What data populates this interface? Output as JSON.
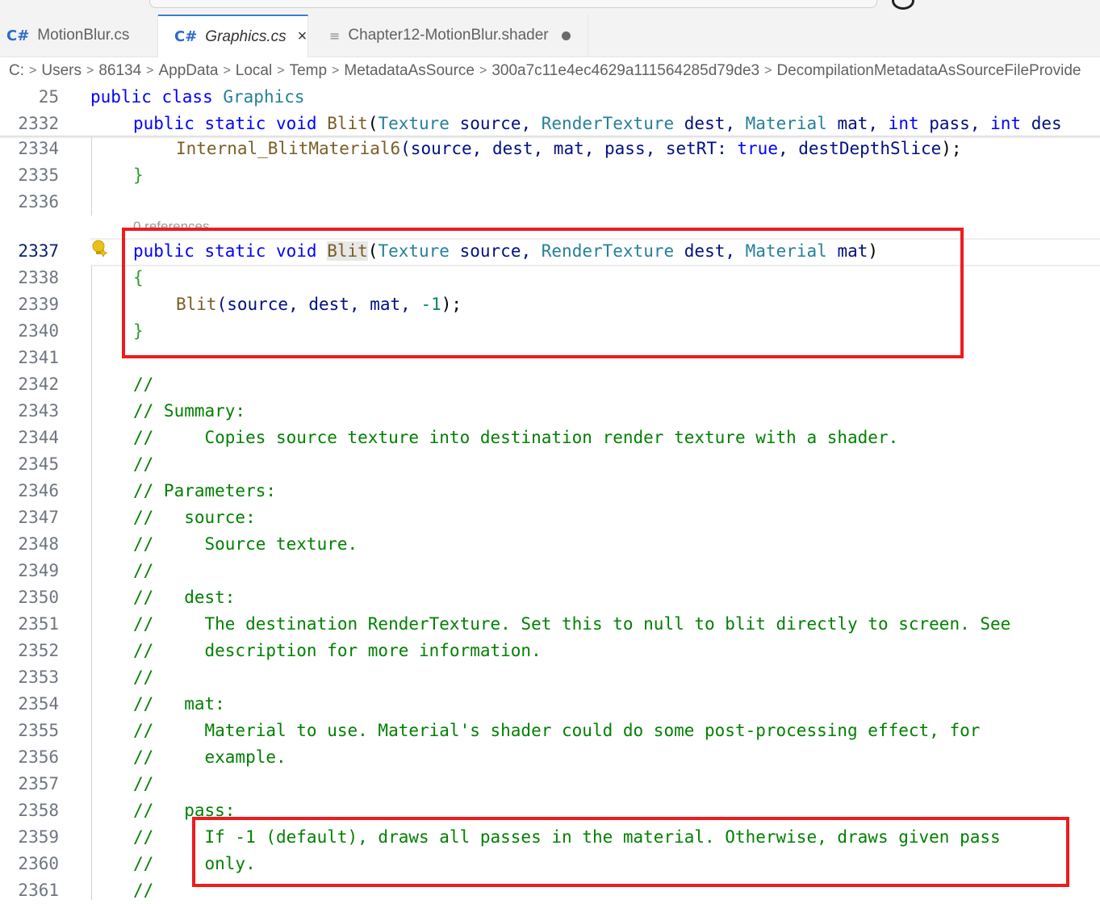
{
  "tabs": [
    {
      "label": "MotionBlur.cs",
      "icon": "C#",
      "state": "inactive"
    },
    {
      "label": "Graphics.cs",
      "icon": "C#",
      "state": "active",
      "close": "×"
    },
    {
      "label": "Chapter12-MotionBlur.shader",
      "icon": "≡",
      "state": "modified"
    }
  ],
  "breadcrumb": [
    "C:",
    "Users",
    "86134",
    "AppData",
    "Local",
    "Temp",
    "MetadataAsSource",
    "300a7c11e4ec4629a111564285d79de3",
    "DecompilationMetadataAsSourceFileProvide"
  ],
  "breadcrumb_separator": ">",
  "codelens": "0 references",
  "colors": {
    "keyword": "#0000ff",
    "type": "#267f99",
    "method": "#795e26",
    "parameter": "#001080",
    "comment": "#008000",
    "number": "#098658",
    "highlight_box": "#ee1c1c"
  },
  "lines": {
    "l25": {
      "num": "25",
      "t1": "public class ",
      "t2": "Graphics"
    },
    "l2332": {
      "num": "2332",
      "a": "public static void ",
      "b": "Blit",
      "c": "(",
      "d": "Texture",
      "e": " source, ",
      "f": "RenderTexture",
      "g": " dest, ",
      "h": "Material",
      "i": " mat, ",
      "j": "int",
      "k": " pass, ",
      "l": "int",
      "m": " des"
    },
    "l2334": {
      "num": "2334",
      "a": "Internal_BlitMaterial6",
      "b": "(source, dest, mat, pass, setRT: ",
      "c": "true",
      "d": ", destDepthSlice",
      "e": ");"
    },
    "l2335": {
      "num": "2335",
      "text": "}"
    },
    "l2336": {
      "num": "2336"
    },
    "l2337": {
      "num": "2337",
      "a": "public static void ",
      "b": "Blit",
      "c": "(",
      "d": "Texture",
      "e": " source, ",
      "f": "RenderTexture",
      "g": " dest, ",
      "h": "Material",
      "i": " mat",
      "j": ")"
    },
    "l2338": {
      "num": "2338",
      "text": "{"
    },
    "l2339": {
      "num": "2339",
      "a": "Blit",
      "b": "(source, dest, mat, ",
      "c": "-1",
      "d": ");"
    },
    "l2340": {
      "num": "2340",
      "text": "}"
    },
    "l2341": {
      "num": "2341"
    },
    "l2342": {
      "num": "2342",
      "text": "//"
    },
    "l2343": {
      "num": "2343",
      "text": "// Summary:"
    },
    "l2344": {
      "num": "2344",
      "text": "//     Copies source texture into destination render texture with a shader."
    },
    "l2345": {
      "num": "2345",
      "text": "//"
    },
    "l2346": {
      "num": "2346",
      "text": "// Parameters:"
    },
    "l2347": {
      "num": "2347",
      "text": "//   source:"
    },
    "l2348": {
      "num": "2348",
      "text": "//     Source texture."
    },
    "l2349": {
      "num": "2349",
      "text": "//"
    },
    "l2350": {
      "num": "2350",
      "text": "//   dest:"
    },
    "l2351": {
      "num": "2351",
      "text": "//     The destination RenderTexture. Set this to null to blit directly to screen. See"
    },
    "l2352": {
      "num": "2352",
      "text": "//     description for more information."
    },
    "l2353": {
      "num": "2353",
      "text": "//"
    },
    "l2354": {
      "num": "2354",
      "text": "//   mat:"
    },
    "l2355": {
      "num": "2355",
      "text": "//     Material to use. Material's shader could do some post-processing effect, for"
    },
    "l2356": {
      "num": "2356",
      "text": "//     example."
    },
    "l2357": {
      "num": "2357",
      "text": "//"
    },
    "l2358": {
      "num": "2358",
      "text": "//   pass:"
    },
    "l2359": {
      "num": "2359",
      "text": "//     If -1 (default), draws all passes in the material. Otherwise, draws given pass"
    },
    "l2360": {
      "num": "2360",
      "text": "//     only."
    },
    "l2361": {
      "num": "2361",
      "text": "//"
    }
  }
}
